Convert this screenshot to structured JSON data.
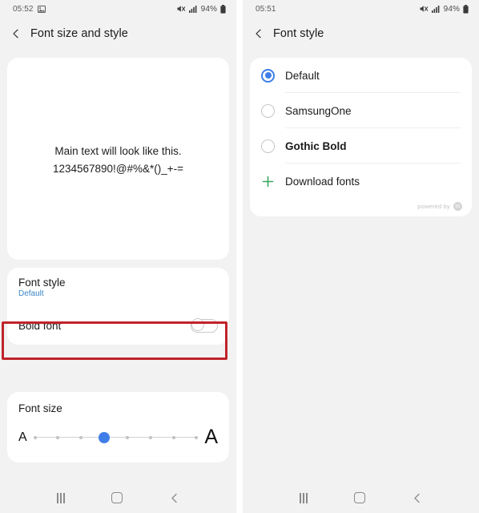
{
  "theme": {
    "page_bg": "#f2f2f2",
    "card_bg": "#ffffff",
    "accent_blue": "#3f7ee8",
    "link_blue": "#3d85c6",
    "highlight_red": "#c0232b",
    "plus_green": "#3aa85f",
    "text_primary": "#1b1b1b",
    "text_muted": "#8a8a8a"
  },
  "left_screen": {
    "status_bar": {
      "time": "05:52",
      "left_icon": "image-icon",
      "mute_icon": "mute-icon",
      "signal_icon": "signal-bars-icon",
      "battery_percent": "94%",
      "battery_icon": "battery-icon"
    },
    "app_bar": {
      "back_icon": "back-chevron-icon",
      "title": "Font size and style"
    },
    "preview": {
      "line1": "Main text will look like this.",
      "line2": "1234567890!@#%&*()_+-="
    },
    "settings": {
      "font_style": {
        "title": "Font style",
        "value": "Default",
        "highlighted": true
      },
      "bold_font": {
        "title": "Bold font",
        "toggle_state": "off"
      }
    },
    "font_size": {
      "title": "Font size",
      "small_letter": "A",
      "large_letter": "A",
      "steps": 8,
      "current_index": 3
    },
    "nav_bar": {
      "recents_icon": "recents-icon",
      "home_icon": "home-icon",
      "back_icon": "back-icon"
    }
  },
  "right_screen": {
    "status_bar": {
      "time": "05:51",
      "mute_icon": "mute-icon",
      "signal_icon": "signal-bars-icon",
      "battery_percent": "94%",
      "battery_icon": "battery-icon"
    },
    "app_bar": {
      "back_icon": "back-chevron-icon",
      "title": "Font style"
    },
    "font_list": [
      {
        "label": "Default",
        "selected": true,
        "bold": false,
        "icon": "radio-icon"
      },
      {
        "label": "SamsungOne",
        "selected": false,
        "bold": false,
        "icon": "radio-icon"
      },
      {
        "label": "Gothic Bold",
        "selected": false,
        "bold": true,
        "icon": "radio-icon"
      },
      {
        "label": "Download fonts",
        "selected": false,
        "bold": false,
        "icon": "plus-icon"
      }
    ],
    "powered_by": {
      "text": "powered by",
      "logo_glyph": "m"
    },
    "nav_bar": {
      "recents_icon": "recents-icon",
      "home_icon": "home-icon",
      "back_icon": "back-icon"
    }
  }
}
